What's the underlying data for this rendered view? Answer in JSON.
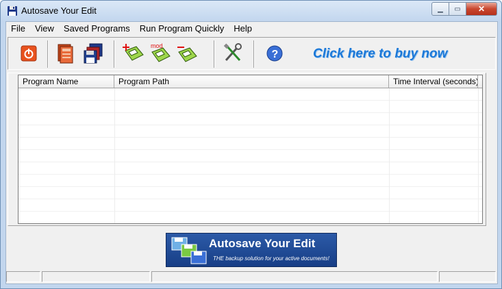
{
  "window": {
    "title": "Autosave Your Edit"
  },
  "menu": [
    "File",
    "View",
    "Saved Programs",
    "Run Program Quickly",
    "Help"
  ],
  "toolbar": {
    "mod_label": "mod",
    "buy_link": "Click here to buy now"
  },
  "table": {
    "columns": [
      "Program Name",
      "Program Path",
      "Time Interval (seconds)"
    ],
    "rows": []
  },
  "banner": {
    "title": "Autosave Your Edit",
    "subtitle": "THE backup solution for your active documents!"
  },
  "status": [
    "",
    "",
    "",
    ""
  ],
  "colors": {
    "accent": "#1b78d8",
    "banner_bg": "#2c5aa7",
    "close_button": "#c9472f"
  }
}
